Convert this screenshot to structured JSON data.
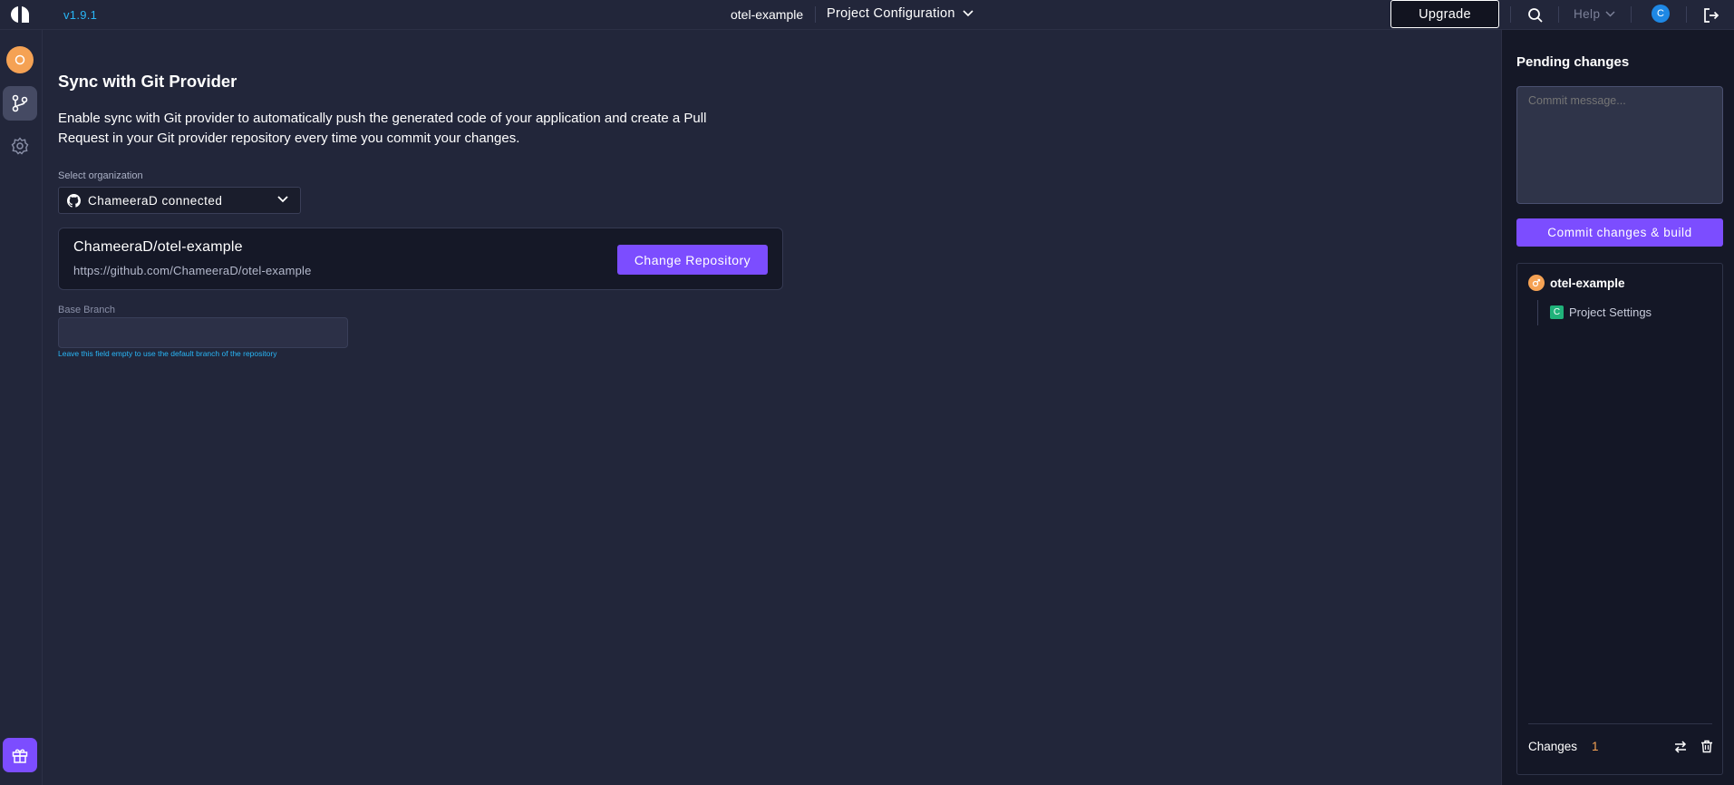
{
  "topbar": {
    "version": "v1.9.1",
    "project_name": "otel-example",
    "project_config_label": "Project Configuration",
    "upgrade_label": "Upgrade",
    "help_label": "Help",
    "avatar_initial": "C"
  },
  "sidebar": {
    "items": [
      {
        "icon": "project-avatar-icon"
      },
      {
        "icon": "git-branch-icon",
        "active": true
      },
      {
        "icon": "gear-icon"
      },
      {
        "icon": "gift-icon"
      }
    ]
  },
  "main": {
    "title": "Sync with Git Provider",
    "description": "Enable sync with Git provider to automatically push the generated code of your application and create a Pull Request in your Git provider repository every time you commit your changes.",
    "org_label": "Select organization",
    "org_value": "ChameeraD connected",
    "repo": {
      "name": "ChameeraD/otel-example",
      "url": "https://github.com/ChameeraD/otel-example",
      "change_label": "Change Repository"
    },
    "branch_label": "Base Branch",
    "branch_value": "",
    "branch_hint": "Leave this field empty to use the default branch of the repository"
  },
  "pending": {
    "title": "Pending changes",
    "commit_placeholder": "Commit message...",
    "commit_button": "Commit changes & build",
    "tree": {
      "root": "otel-example",
      "children": [
        {
          "badge": "C",
          "label": "Project Settings"
        }
      ]
    },
    "changes_label": "Changes",
    "changes_count": "1"
  },
  "colors": {
    "accent": "#7c4dff",
    "link": "#29b6f6",
    "avatar": "#f5a254",
    "background": "#22263a",
    "panel": "#151827"
  }
}
